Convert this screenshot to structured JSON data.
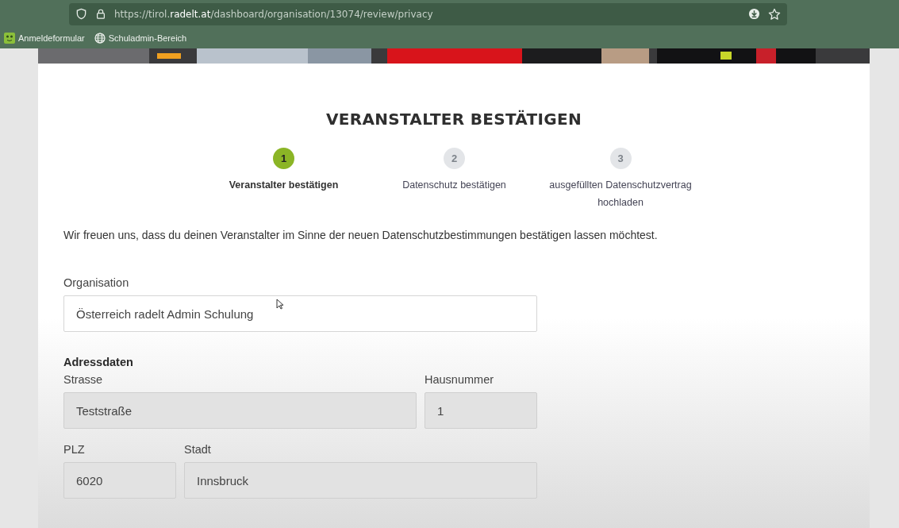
{
  "browser": {
    "url_prefix": "https://tirol.",
    "url_domain": "radelt.at",
    "url_path": "/dashboard/organisation/13074/review/privacy",
    "bookmarks": [
      {
        "label": "Anmeldeformular"
      },
      {
        "label": "Schuladmin-Bereich"
      }
    ]
  },
  "title": "VERANSTALTER BESTÄTIGEN",
  "steps": [
    {
      "number": "1",
      "label": "Veranstalter bestätigen",
      "selected": true
    },
    {
      "number": "2",
      "label": "Datenschutz bestätigen",
      "selected": false
    },
    {
      "number": "3",
      "label": "ausgefüllten Datenschutzvertrag hochladen",
      "selected": false
    }
  ],
  "intro": "Wir freuen uns, dass du deinen Veranstalter im Sinne der neuen Datenschutzbestimmungen bestätigen lassen möchtest.",
  "organisation": {
    "label": "Organisation",
    "value": "Österreich radelt Admin Schulung",
    "disabled": false
  },
  "address": {
    "heading": "Adressdaten",
    "rows": [
      [
        {
          "label": "Strasse",
          "value": "Teststraße",
          "disabled": true
        },
        {
          "label": "Hausnummer",
          "value": "1",
          "disabled": true
        }
      ],
      [
        {
          "label": "PLZ",
          "value": "6020",
          "disabled": true
        },
        {
          "label": "Stadt",
          "value": "Innsbruck",
          "disabled": true
        }
      ]
    ]
  }
}
